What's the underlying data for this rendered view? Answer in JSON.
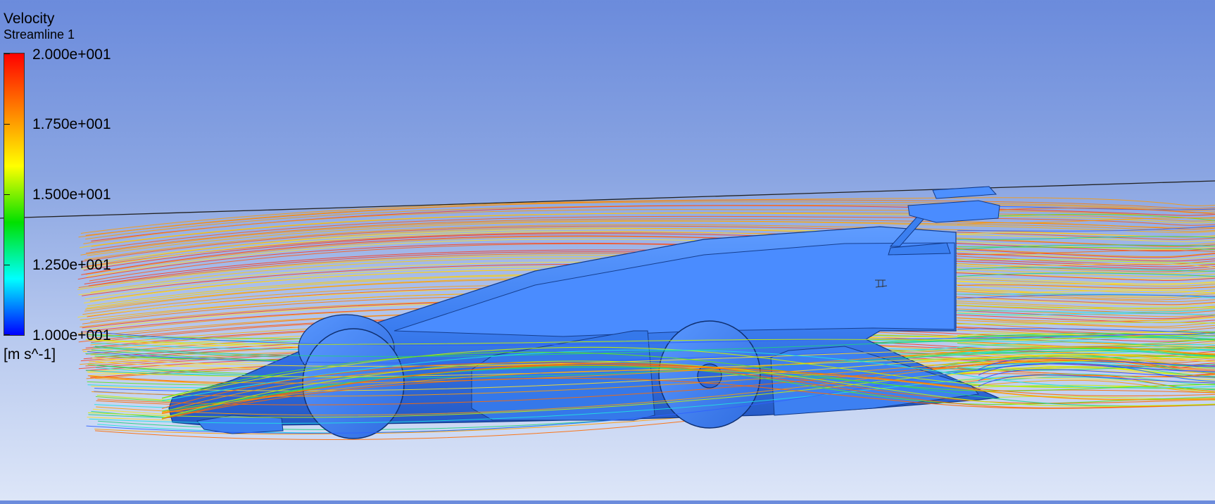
{
  "legend": {
    "variable": "Velocity",
    "object": "Streamline 1",
    "units": "[m s^-1]",
    "ticks": [
      "2.000e+001",
      "1.750e+001",
      "1.500e+001",
      "1.250e+001",
      "1.000e+001"
    ],
    "colormap": [
      "#ff0000",
      "#ff8000",
      "#ffff00",
      "#00e000",
      "#00ffff",
      "#0000ff"
    ]
  },
  "scene": {
    "model": "race-car-body",
    "body_color": "#3a7ff0",
    "visualization": "velocity-streamlines"
  }
}
